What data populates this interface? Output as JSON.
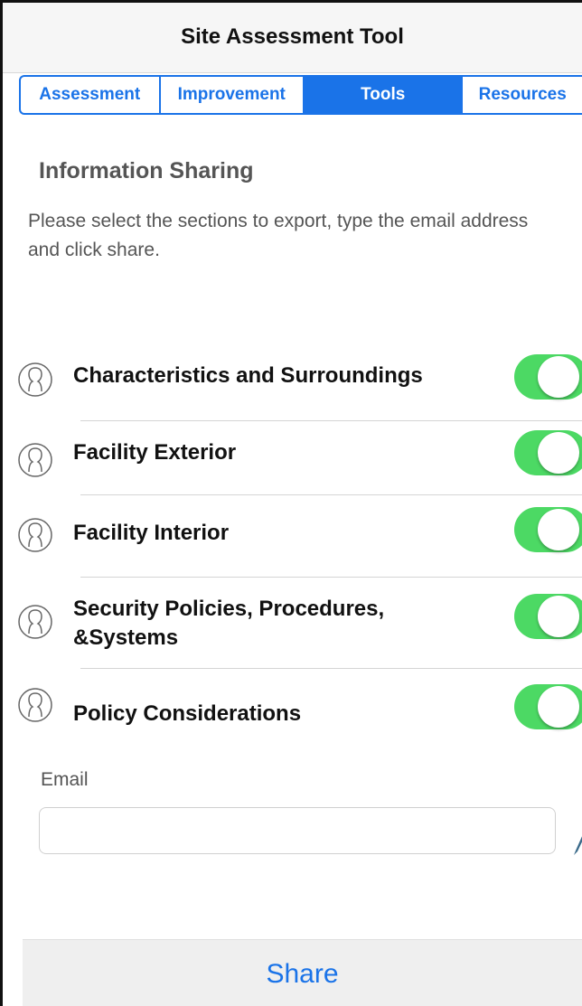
{
  "header": {
    "title": "Site Assessment Tool"
  },
  "tabs": [
    {
      "label": "Assessment",
      "active": false
    },
    {
      "label": "Improvement",
      "active": false
    },
    {
      "label": "Tools",
      "active": true
    },
    {
      "label": "Resources",
      "active": false
    }
  ],
  "section": {
    "title": "Information Sharing",
    "instructions": "Please select the sections to export, type the email address and click share."
  },
  "export_sections": [
    {
      "label": "Characteristics and Surroundings",
      "enabled": true,
      "icon": "person-outline-icon"
    },
    {
      "label": "Facility Exterior",
      "enabled": true,
      "icon": "person-outline-icon"
    },
    {
      "label": "Facility Interior",
      "enabled": true,
      "icon": "person-outline-icon"
    },
    {
      "label": "Security Policies, Procedures, &Systems",
      "enabled": true,
      "icon": "person-outline-icon"
    },
    {
      "label": "Policy Considerations",
      "enabled": true,
      "icon": "person-outline-icon"
    }
  ],
  "email": {
    "label": "Email",
    "value": "",
    "placeholder": ""
  },
  "share_button": {
    "label": "Share"
  },
  "colors": {
    "accent": "#1a73e8",
    "toggle_on": "#4cd964",
    "muted_text": "#555555"
  }
}
